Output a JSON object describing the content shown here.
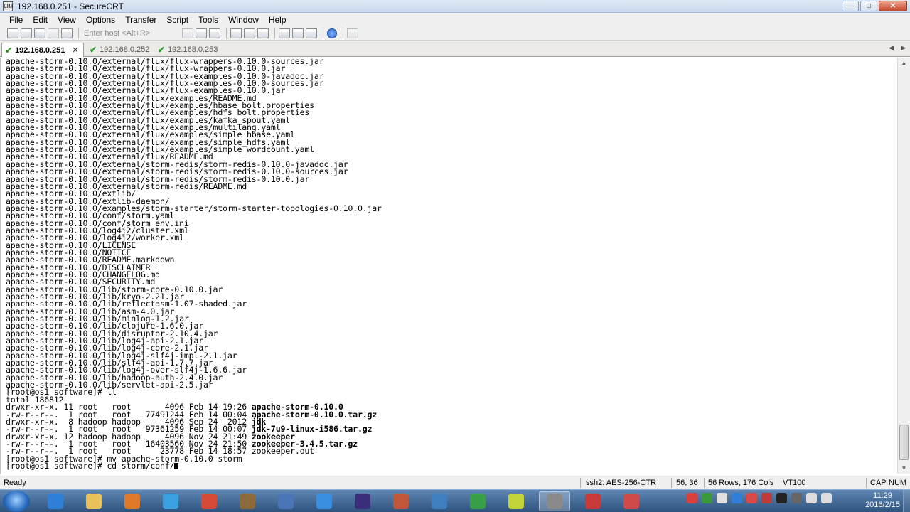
{
  "window": {
    "title": "192.168.0.251 - SecureCRT",
    "app_icon_text": "CRT",
    "controls": {
      "minimize": "—",
      "maximize": "□",
      "close": "✕"
    }
  },
  "menu": [
    "File",
    "Edit",
    "View",
    "Options",
    "Transfer",
    "Script",
    "Tools",
    "Window",
    "Help"
  ],
  "toolbar": {
    "quick_connect_placeholder": "Enter host <Alt+R>"
  },
  "tabs": [
    {
      "label": "192.168.0.251",
      "active": true,
      "status": "connected",
      "close": "✕"
    },
    {
      "label": "192.168.0.252",
      "active": false,
      "status": "connected"
    },
    {
      "label": "192.168.0.253",
      "active": false,
      "status": "connected"
    }
  ],
  "tab_scroll": {
    "left": "◀",
    "right": "▶"
  },
  "terminal": {
    "lines": [
      "apache-storm-0.10.0/external/flux/flux-wrappers-0.10.0-sources.jar",
      "apache-storm-0.10.0/external/flux/flux-wrappers-0.10.0.jar",
      "apache-storm-0.10.0/external/flux/flux-examples-0.10.0-javadoc.jar",
      "apache-storm-0.10.0/external/flux/flux-examples-0.10.0-sources.jar",
      "apache-storm-0.10.0/external/flux/flux-examples-0.10.0.jar",
      "apache-storm-0.10.0/external/flux/examples/README.md",
      "apache-storm-0.10.0/external/flux/examples/hbase_bolt.properties",
      "apache-storm-0.10.0/external/flux/examples/hdfs_bolt.properties",
      "apache-storm-0.10.0/external/flux/examples/kafka_spout.yaml",
      "apache-storm-0.10.0/external/flux/examples/multilang.yaml",
      "apache-storm-0.10.0/external/flux/examples/simple_hbase.yaml",
      "apache-storm-0.10.0/external/flux/examples/simple_hdfs.yaml",
      "apache-storm-0.10.0/external/flux/examples/simple_wordcount.yaml",
      "apache-storm-0.10.0/external/flux/README.md",
      "apache-storm-0.10.0/external/storm-redis/storm-redis-0.10.0-javadoc.jar",
      "apache-storm-0.10.0/external/storm-redis/storm-redis-0.10.0-sources.jar",
      "apache-storm-0.10.0/external/storm-redis/storm-redis-0.10.0.jar",
      "apache-storm-0.10.0/external/storm-redis/README.md",
      "apache-storm-0.10.0/extlib/",
      "apache-storm-0.10.0/extlib-daemon/",
      "apache-storm-0.10.0/examples/storm-starter/storm-starter-topologies-0.10.0.jar",
      "apache-storm-0.10.0/conf/storm.yaml",
      "apache-storm-0.10.0/conf/storm_env.ini",
      "apache-storm-0.10.0/log4j2/cluster.xml",
      "apache-storm-0.10.0/log4j2/worker.xml",
      "apache-storm-0.10.0/LICENSE",
      "apache-storm-0.10.0/NOTICE",
      "apache-storm-0.10.0/README.markdown",
      "apache-storm-0.10.0/DISCLAIMER",
      "apache-storm-0.10.0/CHANGELOG.md",
      "apache-storm-0.10.0/SECURITY.md",
      "apache-storm-0.10.0/lib/storm-core-0.10.0.jar",
      "apache-storm-0.10.0/lib/kryo-2.21.jar",
      "apache-storm-0.10.0/lib/reflectasm-1.07-shaded.jar",
      "apache-storm-0.10.0/lib/asm-4.0.jar",
      "apache-storm-0.10.0/lib/minlog-1.2.jar",
      "apache-storm-0.10.0/lib/clojure-1.6.0.jar",
      "apache-storm-0.10.0/lib/disruptor-2.10.4.jar",
      "apache-storm-0.10.0/lib/log4j-api-2.1.jar",
      "apache-storm-0.10.0/lib/log4j-core-2.1.jar",
      "apache-storm-0.10.0/lib/log4j-slf4j-impl-2.1.jar",
      "apache-storm-0.10.0/lib/slf4j-api-1.7.7.jar",
      "apache-storm-0.10.0/lib/log4j-over-slf4j-1.6.6.jar",
      "apache-storm-0.10.0/lib/hadoop-auth-2.4.0.jar",
      "apache-storm-0.10.0/lib/servlet-api-2.5.jar",
      "[root@os1 software]# ll",
      "total 186812"
    ],
    "ll_rows": [
      {
        "meta": "drwxr-xr-x. 11 root   root       4096 Feb 14 19:26 ",
        "name": "apache-storm-0.10.0",
        "bold": true
      },
      {
        "meta": "-rw-r--r--.  1 root   root   77491244 Feb 14 00:04 ",
        "name": "apache-storm-0.10.0.tar.gz",
        "bold": true
      },
      {
        "meta": "drwxr-xr-x.  8 hadoop hadoop     4096 Sep 24  2012 ",
        "name": "jdk",
        "bold": true
      },
      {
        "meta": "-rw-r--r--.  1 root   root   97361259 Feb 14 00:07 ",
        "name": "jdk-7u9-linux-i586.tar.gz",
        "bold": true
      },
      {
        "meta": "drwxr-xr-x. 12 hadoop hadoop     4096 Nov 24 21:49 ",
        "name": "zookeeper",
        "bold": true
      },
      {
        "meta": "-rw-r--r--.  1 root   root   16403560 Nov 24 21:50 ",
        "name": "zookeeper-3.4.5.tar.gz",
        "bold": true
      },
      {
        "meta": "-rw-r--r--.  1 root   root      23778 Feb 14 18:57 ",
        "name": "zookeeper.out",
        "bold": false
      }
    ],
    "after_lines": [
      "[root@os1 software]# mv apache-storm-0.10.0 storm"
    ],
    "current_prompt": "[root@os1 software]# cd storm/conf/"
  },
  "scrollbar": {
    "up": "▲",
    "down": "▼"
  },
  "statusbar": {
    "state": "Ready",
    "encryption": "ssh2: AES-256-CTR",
    "cursor_pos": "56,  36",
    "dimensions": "56 Rows, 176 Cols",
    "emulation": "VT100",
    "caps": "CAP",
    "num": "NUM"
  },
  "taskbar": {
    "apps": [
      {
        "name": "ie-icon",
        "color": "#2f7fd8"
      },
      {
        "name": "folder-icon",
        "color": "#e8c15a"
      },
      {
        "name": "media-player-icon",
        "color": "#e07a2b"
      },
      {
        "name": "network-icon",
        "color": "#3aa0e0"
      },
      {
        "name": "chrome-icon",
        "color": "#d84a38"
      },
      {
        "name": "archive-icon",
        "color": "#8c6a3a"
      },
      {
        "name": "remote-desktop-icon",
        "color": "#4a76b8"
      },
      {
        "name": "pen-icon",
        "color": "#3b8fe0"
      },
      {
        "name": "eclipse-icon",
        "color": "#3a2e7a"
      },
      {
        "name": "game-icon",
        "color": "#c0563a"
      },
      {
        "name": "virtualbox-icon",
        "color": "#3f7fc0"
      },
      {
        "name": "vpn-icon",
        "color": "#3aa048"
      },
      {
        "name": "mindmap-icon",
        "color": "#c2d43a"
      },
      {
        "name": "securecrt-icon",
        "color": "#8a8a8a"
      },
      {
        "name": "xmind-icon",
        "color": "#c83a3a"
      },
      {
        "name": "tool-icon",
        "color": "#d04a4a"
      }
    ],
    "clock_time": "11:29",
    "clock_date": "2016/2/15"
  }
}
